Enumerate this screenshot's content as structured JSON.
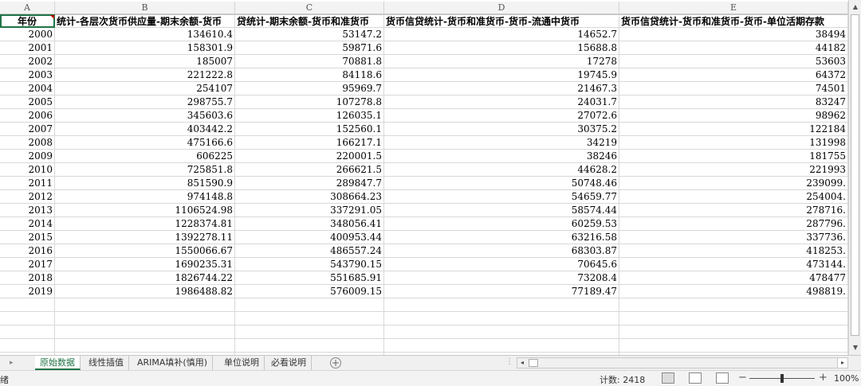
{
  "columns": [
    "A",
    "B",
    "C",
    "D",
    "E"
  ],
  "header_row": [
    "年份",
    "统计-各层次货币供应量-期末余额-货币",
    "贷统计-期末余额-货币和准货币",
    "货币信贷统计-货币和准货币-货币-流通中货币",
    "货币信贷统计-货币和准货币-货币-单位活期存款"
  ],
  "rows": [
    [
      "2000",
      "134610.4",
      "53147.2",
      "14652.7",
      "38494"
    ],
    [
      "2001",
      "158301.9",
      "59871.6",
      "15688.8",
      "44182"
    ],
    [
      "2002",
      "185007",
      "70881.8",
      "17278",
      "53603"
    ],
    [
      "2003",
      "221222.8",
      "84118.6",
      "19745.9",
      "64372"
    ],
    [
      "2004",
      "254107",
      "95969.7",
      "21467.3",
      "74501"
    ],
    [
      "2005",
      "298755.7",
      "107278.8",
      "24031.7",
      "83247"
    ],
    [
      "2006",
      "345603.6",
      "126035.1",
      "27072.6",
      "98962"
    ],
    [
      "2007",
      "403442.2",
      "152560.1",
      "30375.2",
      "122184"
    ],
    [
      "2008",
      "475166.6",
      "166217.1",
      "34219",
      "131998"
    ],
    [
      "2009",
      "606225",
      "220001.5",
      "38246",
      "181755"
    ],
    [
      "2010",
      "725851.8",
      "266621.5",
      "44628.2",
      "221993"
    ],
    [
      "2011",
      "851590.9",
      "289847.7",
      "50748.46",
      "239099."
    ],
    [
      "2012",
      "974148.8",
      "308664.23",
      "54659.77",
      "254004."
    ],
    [
      "2013",
      "1106524.98",
      "337291.05",
      "58574.44",
      "278716."
    ],
    [
      "2014",
      "1228374.81",
      "348056.41",
      "60259.53",
      "287796."
    ],
    [
      "2015",
      "1392278.11",
      "400953.44",
      "63216.58",
      "337736."
    ],
    [
      "2016",
      "1550066.67",
      "486557.24",
      "68303.87",
      "418253."
    ],
    [
      "2017",
      "1690235.31",
      "543790.15",
      "70645.6",
      "473144."
    ],
    [
      "2018",
      "1826744.22",
      "551685.91",
      "73208.4",
      "478477"
    ],
    [
      "2019",
      "1986488.82",
      "576009.15",
      "77189.47",
      "498819."
    ]
  ],
  "empty_rows": 5,
  "sheet_tabs": [
    {
      "label": "原始数据",
      "active": true
    },
    {
      "label": "线性插值",
      "active": false
    },
    {
      "label": "ARIMA填补(慎用)",
      "active": false
    },
    {
      "label": "单位说明",
      "active": false
    },
    {
      "label": "必看说明",
      "active": false
    }
  ],
  "status": {
    "left_text": "绪",
    "count_label": "计数: 2418",
    "zoom_level": "100%"
  },
  "colors": {
    "accent": "#217346",
    "comment_marker": "#c00000"
  }
}
